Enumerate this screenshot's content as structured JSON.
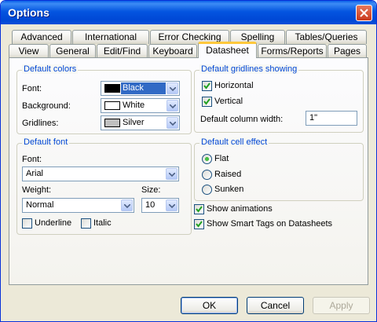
{
  "window": {
    "title": "Options"
  },
  "tabs": {
    "row1": [
      "Advanced",
      "International",
      "Error Checking",
      "Spelling",
      "Tables/Queries"
    ],
    "row2": [
      "View",
      "General",
      "Edit/Find",
      "Keyboard",
      "Datasheet",
      "Forms/Reports",
      "Pages"
    ],
    "active": "Datasheet"
  },
  "default_colors": {
    "title": "Default colors",
    "font_label": "Font:",
    "font_value": "Black",
    "font_swatch": "#000000",
    "background_label": "Background:",
    "background_value": "White",
    "background_swatch": "#ffffff",
    "gridlines_label": "Gridlines:",
    "gridlines_value": "Silver",
    "gridlines_swatch": "#c0c0c0"
  },
  "default_font": {
    "title": "Default font",
    "font_label": "Font:",
    "font_value": "Arial",
    "weight_label": "Weight:",
    "weight_value": "Normal",
    "size_label": "Size:",
    "size_value": "10",
    "underline_label": "Underline",
    "underline_checked": false,
    "italic_label": "Italic",
    "italic_checked": false
  },
  "gridlines": {
    "title": "Default gridlines showing",
    "horizontal_label": "Horizontal",
    "horizontal_checked": true,
    "vertical_label": "Vertical",
    "vertical_checked": true,
    "column_width_label": "Default column width:",
    "column_width_value": "1\""
  },
  "cell_effect": {
    "title": "Default cell effect",
    "options": [
      "Flat",
      "Raised",
      "Sunken"
    ],
    "selected": "Flat"
  },
  "show_animations": {
    "label": "Show animations",
    "checked": true
  },
  "show_smart_tags": {
    "label": "Show Smart Tags on Datasheets",
    "checked": true
  },
  "buttons": {
    "ok": "OK",
    "cancel": "Cancel",
    "apply": "Apply"
  }
}
